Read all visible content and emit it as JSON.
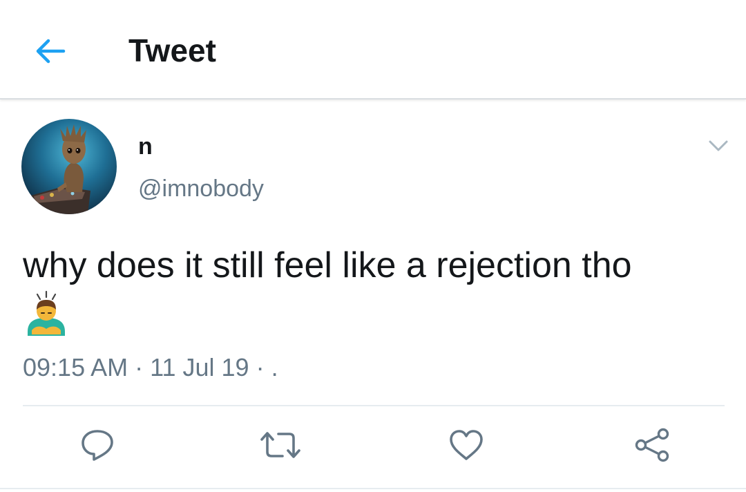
{
  "header": {
    "title": "Tweet",
    "back_icon": "arrow-left-icon"
  },
  "tweet": {
    "display_name": "n",
    "handle": "@imnobody",
    "text": "why does it still feel like a rejection tho",
    "emoji": "person-bowing-emoji",
    "time": "09:15 AM",
    "separator": "·",
    "date": "11 Jul 19",
    "trailing": "· ."
  },
  "actions": {
    "reply_icon": "reply-icon",
    "retweet_icon": "retweet-icon",
    "like_icon": "heart-icon",
    "share_icon": "share-icon"
  },
  "colors": {
    "accent": "#1da1f2",
    "text_primary": "#14171a",
    "text_secondary": "#657786",
    "divider": "#e6ecf0"
  }
}
